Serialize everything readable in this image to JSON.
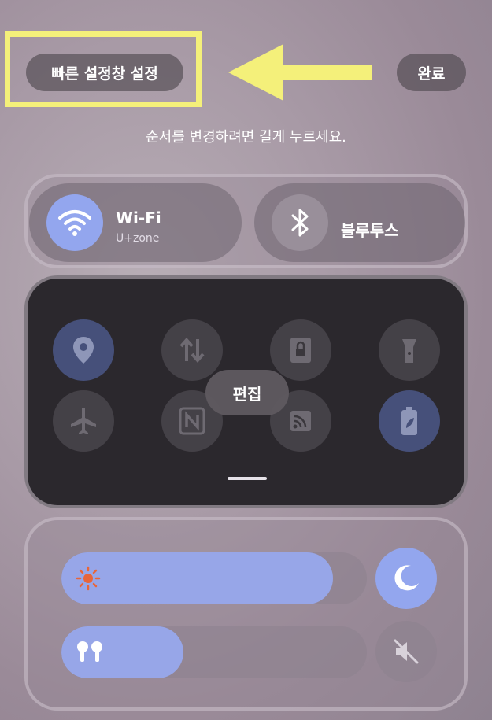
{
  "header": {
    "qs_settings_label": "빠른 설정창 설정",
    "done_label": "완료",
    "hint": "순서를 변경하려면 길게 누르세요."
  },
  "toggles": {
    "wifi": {
      "title": "Wi-Fi",
      "subtitle": "U+zone",
      "icon": "wifi-icon",
      "active": true
    },
    "bluetooth": {
      "title": "블루투스",
      "icon": "bluetooth-icon",
      "active": false
    }
  },
  "grid": {
    "edit_label": "편집",
    "tiles": [
      {
        "icon": "location-icon",
        "active": true
      },
      {
        "icon": "data-transfer-icon",
        "active": false
      },
      {
        "icon": "screen-lock-icon",
        "active": false
      },
      {
        "icon": "flashlight-icon",
        "active": false
      },
      {
        "icon": "airplane-icon",
        "active": false
      },
      {
        "icon": "nfc-icon",
        "active": false
      },
      {
        "icon": "cast-icon",
        "active": false
      },
      {
        "icon": "power-saving-icon",
        "active": true
      }
    ]
  },
  "sliders": {
    "brightness": {
      "icon": "sun-icon",
      "level": 0.89
    },
    "volume": {
      "icon": "earbuds-icon",
      "level": 0.4
    },
    "night_mode": {
      "icon": "moon-icon",
      "active": true
    },
    "mute": {
      "icon": "mute-icon",
      "active": false
    }
  },
  "colors": {
    "accent": "#93a6ee",
    "highlight": "#f4f07a",
    "sun": "#e8653a"
  }
}
